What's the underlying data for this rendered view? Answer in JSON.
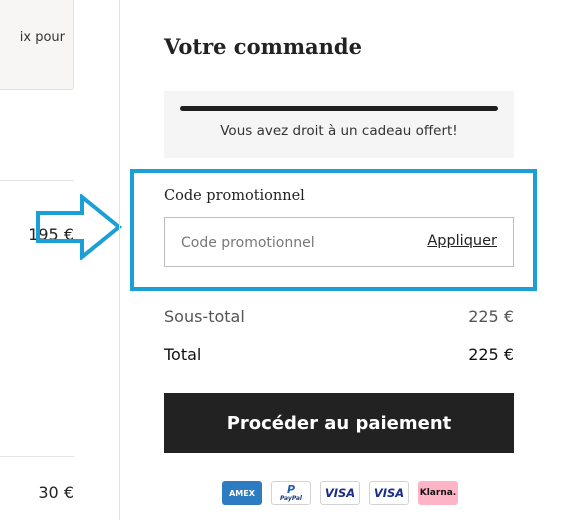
{
  "left": {
    "card_text": "ix pour",
    "prices": [
      "195 €",
      "30 €"
    ]
  },
  "order": {
    "title": "Votre commande",
    "gift_message": "Vous avez droit à un cadeau offert!",
    "gift_progress": 1.0,
    "promo": {
      "label": "Code promotionnel",
      "placeholder": "Code promotionnel",
      "value": "",
      "apply_label": "Appliquer"
    },
    "summary": {
      "subtotal_label": "Sous-total",
      "subtotal_value": "225 €",
      "total_label": "Total",
      "total_value": "225 €"
    },
    "checkout_label": "Procéder au paiement",
    "payment_methods": [
      {
        "name": "amex",
        "text": "AMEX"
      },
      {
        "name": "paypal",
        "text": "PayPal"
      },
      {
        "name": "visa",
        "text": "VISA"
      },
      {
        "name": "visa-debit",
        "text": "VISA"
      },
      {
        "name": "klarna",
        "text": "Klarna."
      }
    ]
  },
  "colors": {
    "highlight": "#1a9fd6",
    "button": "#222222",
    "gift_bg": "#f5f5f5"
  }
}
